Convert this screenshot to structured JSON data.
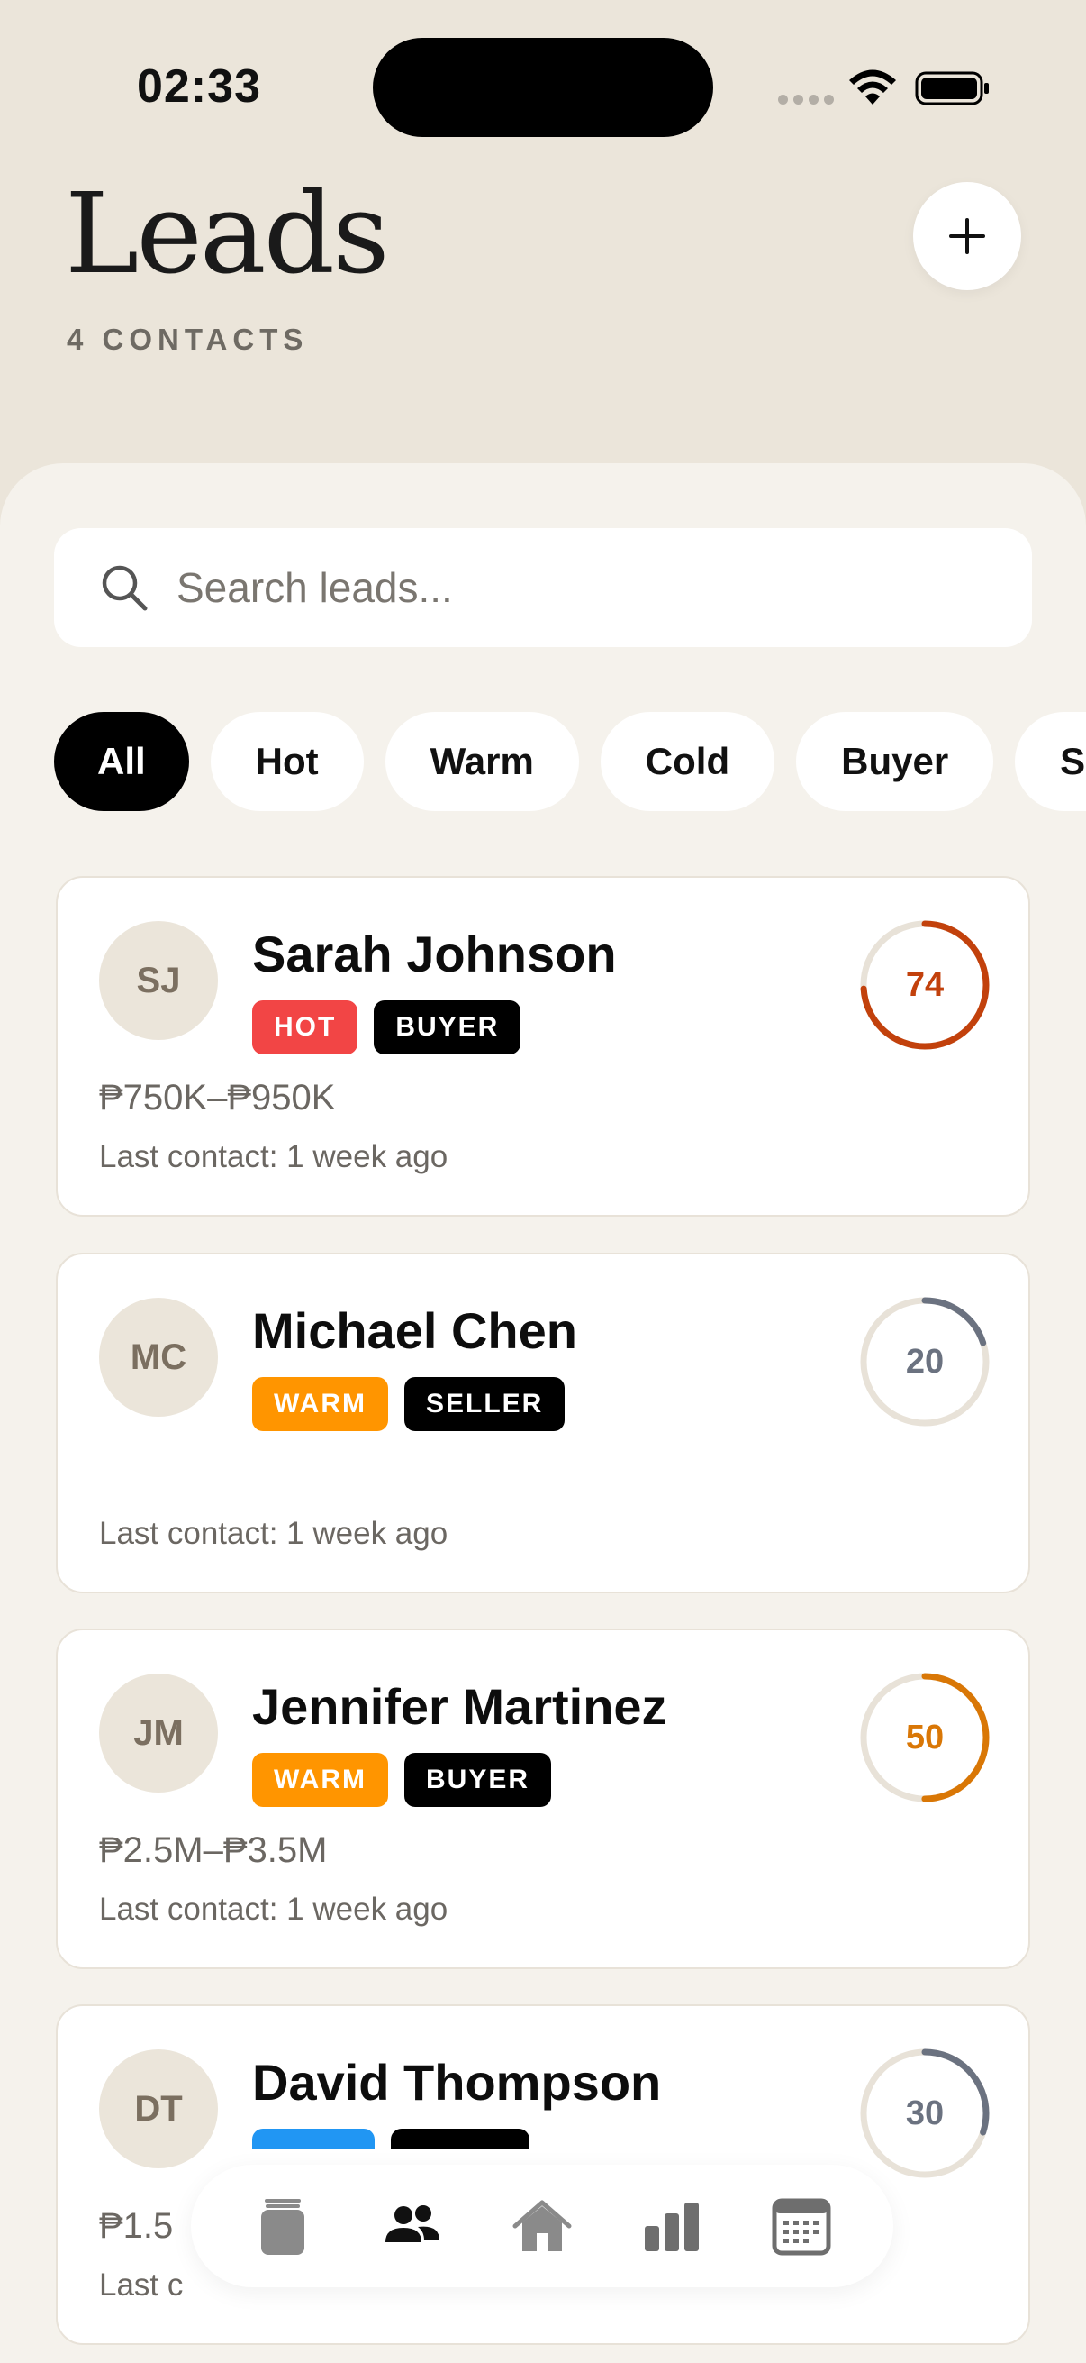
{
  "status_bar": {
    "time": "02:33"
  },
  "header": {
    "title": "Leads",
    "subtitle": "4 CONTACTS",
    "add_icon": "plus-icon"
  },
  "search": {
    "placeholder": "Search leads...",
    "value": ""
  },
  "filters": [
    {
      "label": "All",
      "active": true
    },
    {
      "label": "Hot",
      "active": false
    },
    {
      "label": "Warm",
      "active": false
    },
    {
      "label": "Cold",
      "active": false
    },
    {
      "label": "Buyer",
      "active": false
    },
    {
      "label": "Seller",
      "active": false
    }
  ],
  "leads": [
    {
      "initials": "SJ",
      "name": "Sarah Johnson",
      "tags": [
        {
          "label": "HOT",
          "color": "#f24545"
        },
        {
          "label": "BUYER",
          "color": "#000000"
        }
      ],
      "budget": "₱750K–₱950K",
      "last_contact": "Last contact: 1 week ago",
      "score": 74,
      "score_color": "#c2410c"
    },
    {
      "initials": "MC",
      "name": "Michael Chen",
      "tags": [
        {
          "label": "WARM",
          "color": "#ff9500"
        },
        {
          "label": "SELLER",
          "color": "#000000"
        }
      ],
      "budget": "",
      "last_contact": "Last contact: 1 week ago",
      "score": 20,
      "score_color": "#6b7280"
    },
    {
      "initials": "JM",
      "name": "Jennifer Martinez",
      "tags": [
        {
          "label": "WARM",
          "color": "#ff9500"
        },
        {
          "label": "BUYER",
          "color": "#000000"
        }
      ],
      "budget": "₱2.5M–₱3.5M",
      "last_contact": "Last contact: 1 week ago",
      "score": 50,
      "score_color": "#d97706"
    },
    {
      "initials": "DT",
      "name": "David Thompson",
      "tags": [
        {
          "label": "",
          "color": "#2196f3"
        },
        {
          "label": "",
          "color": "#000000"
        }
      ],
      "budget": "₱1.5",
      "last_contact": "Last c",
      "score": 30,
      "score_color": "#6b7280"
    }
  ],
  "tabbar": {
    "items": [
      {
        "icon": "jar-icon",
        "active": false
      },
      {
        "icon": "people-icon",
        "active": true
      },
      {
        "icon": "house-icon",
        "active": false
      },
      {
        "icon": "bar-chart-icon",
        "active": false
      },
      {
        "icon": "calendar-icon",
        "active": false
      }
    ]
  },
  "colors": {
    "background": "#ebe5da",
    "sheet": "#f5f2ec",
    "ring_track": "#e8e2d8"
  }
}
